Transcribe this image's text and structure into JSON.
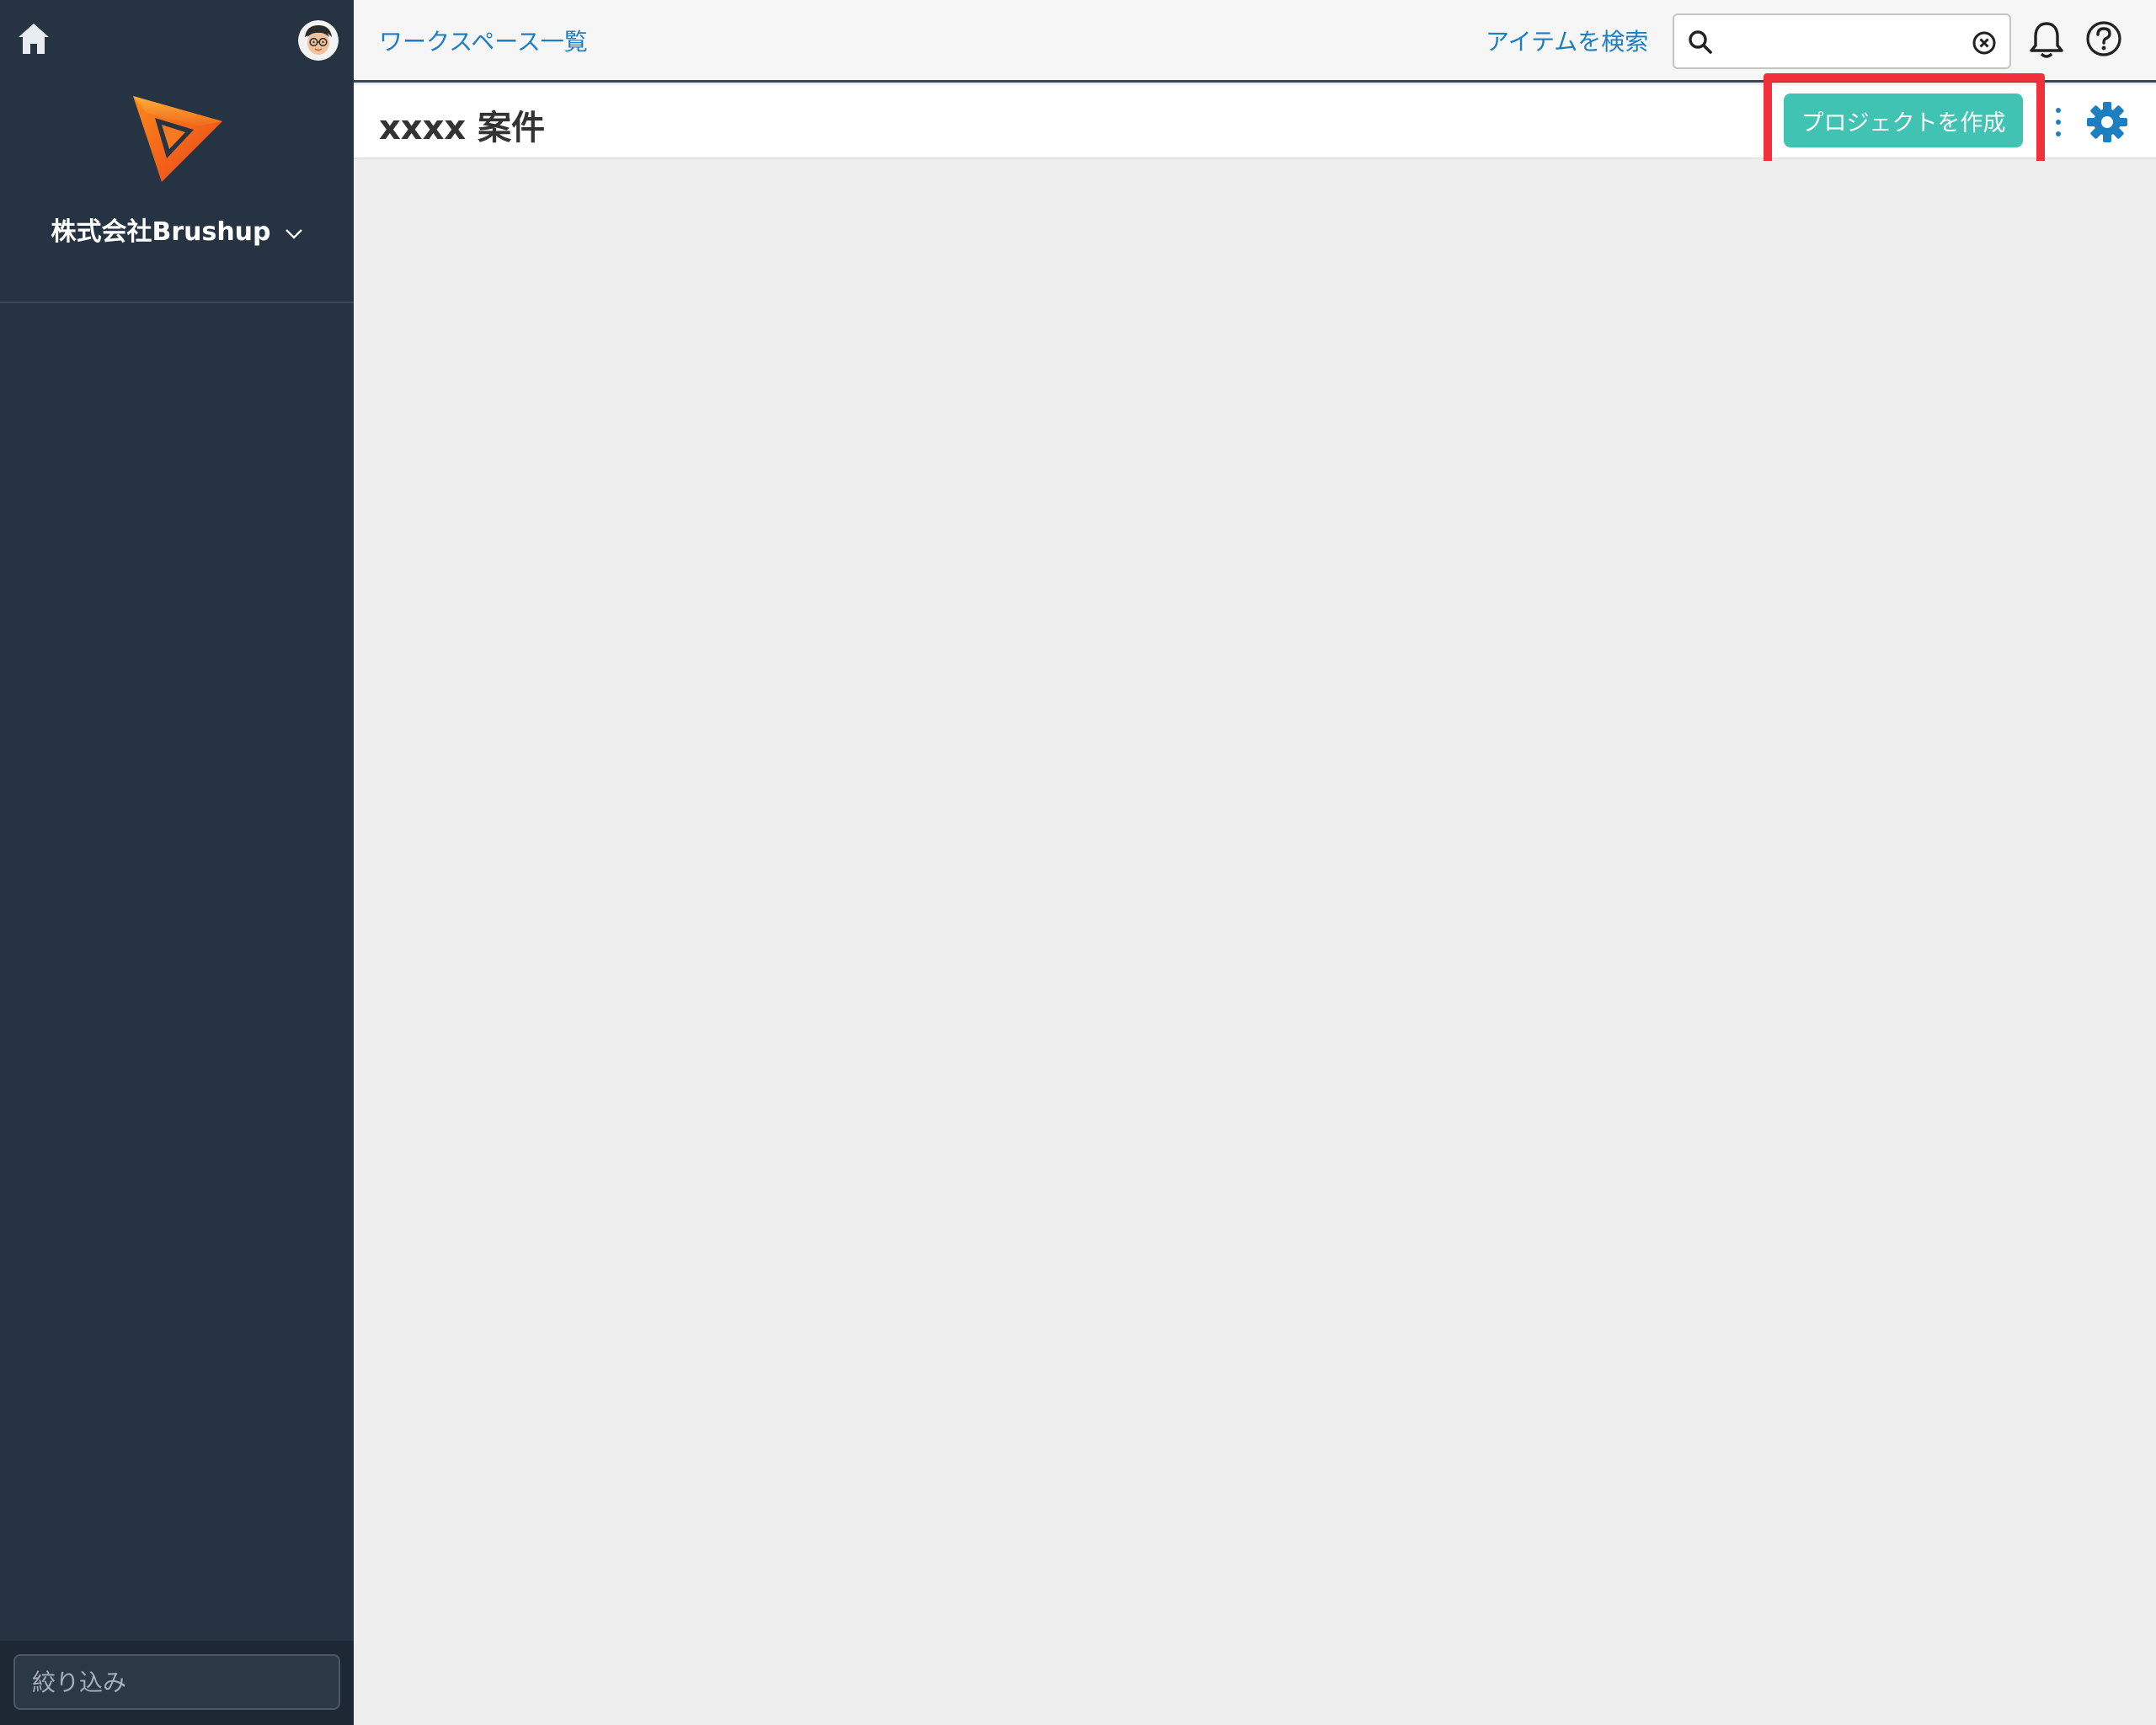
{
  "sidebar": {
    "org_name": "株式会社Brushup",
    "filter_placeholder": "絞り込み"
  },
  "topbar": {
    "workspace_list_link": "ワークスペース一覧",
    "search_label": "アイテムを検索",
    "search_value": ""
  },
  "header": {
    "title": "xxxx 案件",
    "create_project_button": "プロジェクトを作成"
  },
  "colors": {
    "sidebar_bg": "#263342",
    "link": "#1d7fc0",
    "primary_button": "#41c3b4",
    "highlight": "#f2303a",
    "gear": "#1d7fc0"
  },
  "icons": {
    "home": "home-icon",
    "avatar": "user-avatar",
    "logo": "brushup-logo",
    "org_dropdown": "chevron-down-icon",
    "search": "search-icon",
    "clear": "clear-icon",
    "notifications": "bell-icon",
    "help": "help-icon",
    "more": "more-vertical-icon",
    "settings": "gear-icon"
  }
}
